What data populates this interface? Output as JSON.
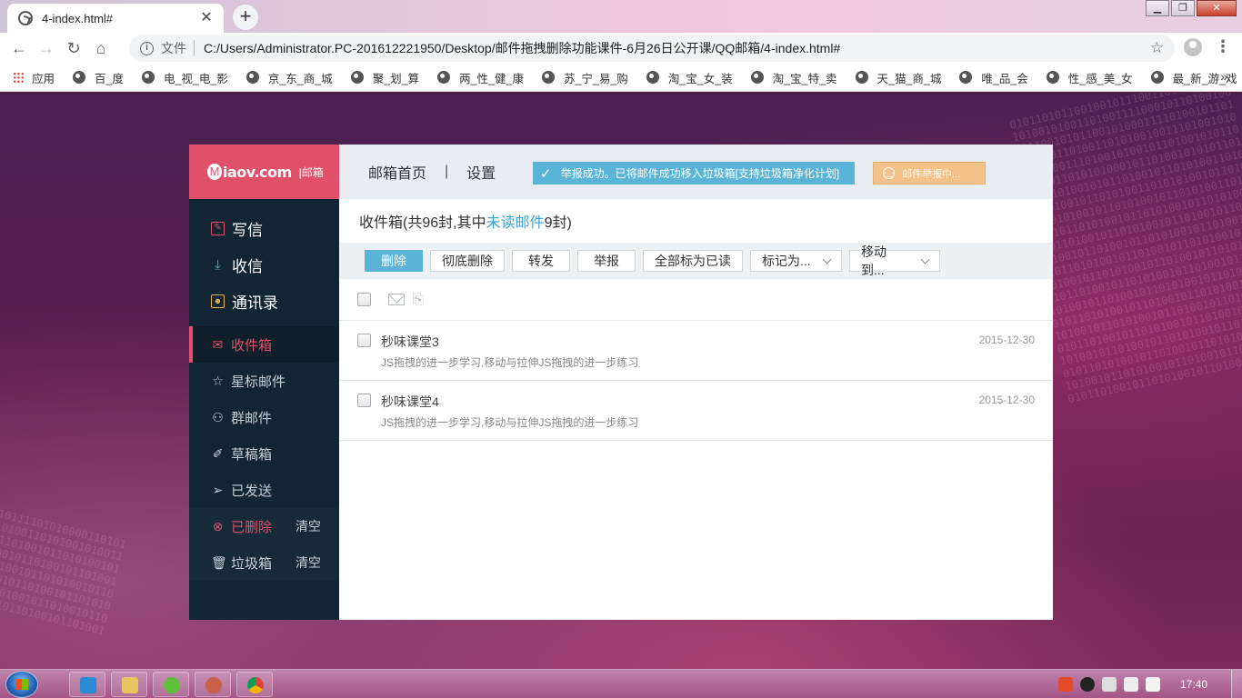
{
  "browser": {
    "tab_title": "4-index.html#",
    "tab_close": "✕",
    "new_tab": "+",
    "window_buttons": {
      "minimize": "▁",
      "maximize": "❐",
      "close": "✕"
    },
    "address": {
      "scheme_label": "文件",
      "url": "C:/Users/Administrator.PC-201612221950/Desktop/邮件拖拽删除功能课件-6月26日公开课/QQ邮箱/4-index.html#"
    },
    "bookmarks": [
      {
        "label": "应用"
      },
      {
        "label": "百_度"
      },
      {
        "label": "电_视_电_影"
      },
      {
        "label": "京_东_商_城"
      },
      {
        "label": "聚_划_算"
      },
      {
        "label": "两_性_健_康"
      },
      {
        "label": "苏_宁_易_购"
      },
      {
        "label": "淘_宝_女_装"
      },
      {
        "label": "淘_宝_特_卖"
      },
      {
        "label": "天_猫_商_城"
      },
      {
        "label": "唯_品_会"
      },
      {
        "label": "性_感_美_女"
      },
      {
        "label": "最_新_游_戏"
      }
    ],
    "bookmarks_more": "»"
  },
  "app": {
    "logo": {
      "text": "iaov.com",
      "mark": "M",
      "sub": "|邮箱"
    },
    "actions": [
      {
        "label": "写信",
        "icon": "compose-icon"
      },
      {
        "label": "收信",
        "icon": "download-icon"
      },
      {
        "label": "通讯录",
        "icon": "contacts-icon"
      }
    ],
    "folders": [
      {
        "label": "收件箱",
        "icon": "envelope-icon",
        "active": true
      },
      {
        "label": "星标邮件",
        "icon": "star-icon"
      },
      {
        "label": "群邮件",
        "icon": "group-icon"
      },
      {
        "label": "草稿箱",
        "icon": "draft-icon"
      },
      {
        "label": "已发送",
        "icon": "send-icon"
      },
      {
        "label": "已删除",
        "icon": "deleted-icon",
        "clear": "清空"
      },
      {
        "label": "垃圾箱",
        "icon": "trash-icon",
        "clear": "清空"
      }
    ],
    "topnav": {
      "home": "邮箱首页",
      "divider": "|",
      "settings": "设置"
    },
    "notice_success": "举报成功。已将邮件成功移入垃圾箱[支持垃圾箱净化计划]",
    "notice_pending": "邮件举报中...",
    "inbox": {
      "prefix": "收件箱(共96封,其中",
      "unread_link": "未读邮件",
      "suffix": "9封)"
    },
    "toolbar": {
      "delete": "删除",
      "delete_forever": "彻底删除",
      "forward": "转发",
      "report": "举报",
      "mark_all_read": "全部标为已读",
      "mark_as": "标记为...",
      "move_to": "移动到..."
    },
    "mails": [
      {
        "sender": "秒味课堂3",
        "preview": "JS拖拽的进一步学习,移动与拉伸JS拖拽的进一步练习",
        "date": "2015-12-30"
      },
      {
        "sender": "秒味课堂4",
        "preview": "JS拖拽的进一步学习,移动与拉伸JS拖拽的进一步练习",
        "date": "2015-12-30"
      }
    ],
    "colors": {
      "accent": "#e05169",
      "sidebar": "#122533",
      "primary_button": "#5ab4d8",
      "link": "#3ba3d6"
    }
  },
  "taskbar": {
    "clock": "17:40"
  }
}
